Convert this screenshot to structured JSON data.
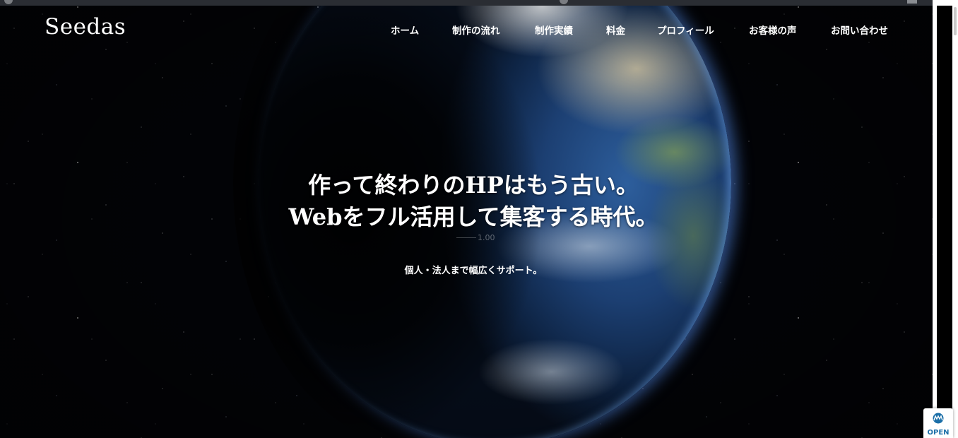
{
  "site": {
    "logo": "Seedas"
  },
  "nav": {
    "items": [
      {
        "label": "ホーム"
      },
      {
        "label": "制作の流れ"
      },
      {
        "label": "制作実績"
      },
      {
        "label": "料金"
      },
      {
        "label": "プロフィール"
      },
      {
        "label": "お客様の声"
      },
      {
        "label": "お問い合わせ"
      }
    ]
  },
  "hero": {
    "title_line1": "作って終わりのHPはもう古い。",
    "title_line2": "Webをフル活用して集客する時代。",
    "subtitle": "個人・法人まで幅広くサポート。",
    "video_speed": "1.00"
  },
  "widget": {
    "label": "OPEN",
    "icon": "chat-widget-icon",
    "color": "#1b6fa8"
  },
  "colors": {
    "background": "#020306",
    "text": "#ffffff",
    "earth_glow": "#5a96ff"
  }
}
